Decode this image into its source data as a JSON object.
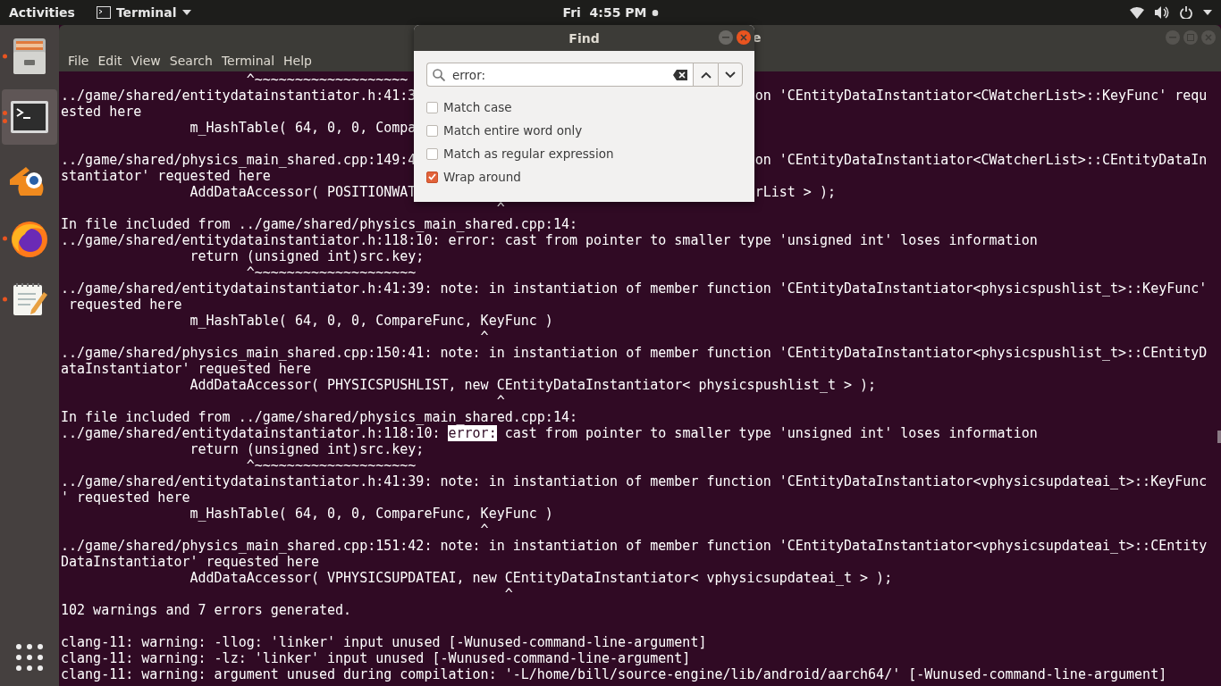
{
  "top_bar": {
    "activities": "Activities",
    "app_menu": "Terminal",
    "clock": "Fri  4:55 PM"
  },
  "dock": {
    "items": [
      {
        "kind": "files",
        "running": true,
        "active": false
      },
      {
        "kind": "terminal",
        "running": true,
        "multiple_windows": true,
        "active": true
      },
      {
        "kind": "blender",
        "running": false,
        "active": false
      },
      {
        "kind": "firefox",
        "running": true,
        "active": false
      },
      {
        "kind": "editor",
        "running": true,
        "active": false
      }
    ]
  },
  "terminal": {
    "title": "e",
    "menu": [
      "File",
      "Edit",
      "View",
      "Search",
      "Terminal",
      "Help"
    ],
    "lines": [
      {
        "kind": "plain",
        "text": "                       ^~~~~~~~~~~~~~~~~~~~"
      },
      {
        "kind": "covered",
        "text": "../game/shared/entitydatainstantiator.h:41:3",
        "tail": "on 'CEntityDataInstantiator<CWatcherList>::KeyFunc' requ"
      },
      {
        "kind": "plain",
        "text": "ested here"
      },
      {
        "kind": "plain",
        "text": "                m_HashTable( 64, 0, 0, Compa"
      },
      {
        "kind": "blank"
      },
      {
        "kind": "covered",
        "text": "../game/shared/physics_main_shared.cpp:149:4",
        "tail": "on 'CEntityDataInstantiator<CWatcherList>::CEntityDataIn"
      },
      {
        "kind": "plain",
        "text": "stantiator' requested here"
      },
      {
        "kind": "covered",
        "text": "                AddDataAccessor( POSITIONWAT",
        "tail": "rList > );"
      },
      {
        "kind": "plain",
        "text": "                                                      ^"
      },
      {
        "kind": "plain",
        "text": "In file included from ../game/shared/physics_main_shared.cpp:14:"
      },
      {
        "kind": "plain",
        "text": "../game/shared/entitydatainstantiator.h:118:10: error: cast from pointer to smaller type 'unsigned int' loses information"
      },
      {
        "kind": "plain",
        "text": "                return (unsigned int)src.key;"
      },
      {
        "kind": "plain",
        "text": "                       ^~~~~~~~~~~~~~~~~~~~~"
      },
      {
        "kind": "plain",
        "text": "../game/shared/entitydatainstantiator.h:41:39: note: in instantiation of member function 'CEntityDataInstantiator<physicspushlist_t>::KeyFunc'"
      },
      {
        "kind": "plain",
        "text": " requested here"
      },
      {
        "kind": "plain",
        "text": "                m_HashTable( 64, 0, 0, CompareFunc, KeyFunc )"
      },
      {
        "kind": "plain",
        "text": "                                                    ^"
      },
      {
        "kind": "plain",
        "text": "../game/shared/physics_main_shared.cpp:150:41: note: in instantiation of member function 'CEntityDataInstantiator<physicspushlist_t>::CEntityD"
      },
      {
        "kind": "plain",
        "text": "ataInstantiator' requested here"
      },
      {
        "kind": "plain",
        "text": "                AddDataAccessor( PHYSICSPUSHLIST, new CEntityDataInstantiator< physicspushlist_t > );"
      },
      {
        "kind": "plain",
        "text": "                                                      ^"
      },
      {
        "kind": "plain",
        "text": "In file included from ../game/shared/physics_main_shared.cpp:14:"
      },
      {
        "kind": "match",
        "text": "../game/shared/entitydatainstantiator.h:118:10: ",
        "match": "error:",
        "tail": " cast from pointer to smaller type 'unsigned int' loses information"
      },
      {
        "kind": "plain",
        "text": "                return (unsigned int)src.key;"
      },
      {
        "kind": "plain",
        "text": "                       ^~~~~~~~~~~~~~~~~~~~~"
      },
      {
        "kind": "plain",
        "text": "../game/shared/entitydatainstantiator.h:41:39: note: in instantiation of member function 'CEntityDataInstantiator<vphysicsupdateai_t>::KeyFunc"
      },
      {
        "kind": "plain",
        "text": "' requested here"
      },
      {
        "kind": "plain",
        "text": "                m_HashTable( 64, 0, 0, CompareFunc, KeyFunc )"
      },
      {
        "kind": "plain",
        "text": "                                                    ^"
      },
      {
        "kind": "plain",
        "text": "../game/shared/physics_main_shared.cpp:151:42: note: in instantiation of member function 'CEntityDataInstantiator<vphysicsupdateai_t>::CEntity"
      },
      {
        "kind": "plain",
        "text": "DataInstantiator' requested here"
      },
      {
        "kind": "plain",
        "text": "                AddDataAccessor( VPHYSICSUPDATEAI, new CEntityDataInstantiator< vphysicsupdateai_t > );"
      },
      {
        "kind": "plain",
        "text": "                                                       ^"
      },
      {
        "kind": "plain",
        "text": "102 warnings and 7 errors generated."
      },
      {
        "kind": "blank"
      },
      {
        "kind": "plain",
        "text": "clang-11: warning: -llog: 'linker' input unused [-Wunused-command-line-argument]"
      },
      {
        "kind": "plain",
        "text": "clang-11: warning: -lz: 'linker' input unused [-Wunused-command-line-argument]"
      },
      {
        "kind": "plain",
        "text": "clang-11: warning: argument unused during compilation: '-L/home/bill/source-engine/lib/android/aarch64/' [-Wunused-command-line-argument]"
      }
    ]
  },
  "find_dialog": {
    "title": "Find",
    "query": "error:",
    "options": [
      {
        "label": "Match case",
        "checked": false
      },
      {
        "label": "Match entire word only",
        "checked": false
      },
      {
        "label": "Match as regular expression",
        "checked": false
      },
      {
        "label": "Wrap around",
        "checked": true
      }
    ]
  }
}
